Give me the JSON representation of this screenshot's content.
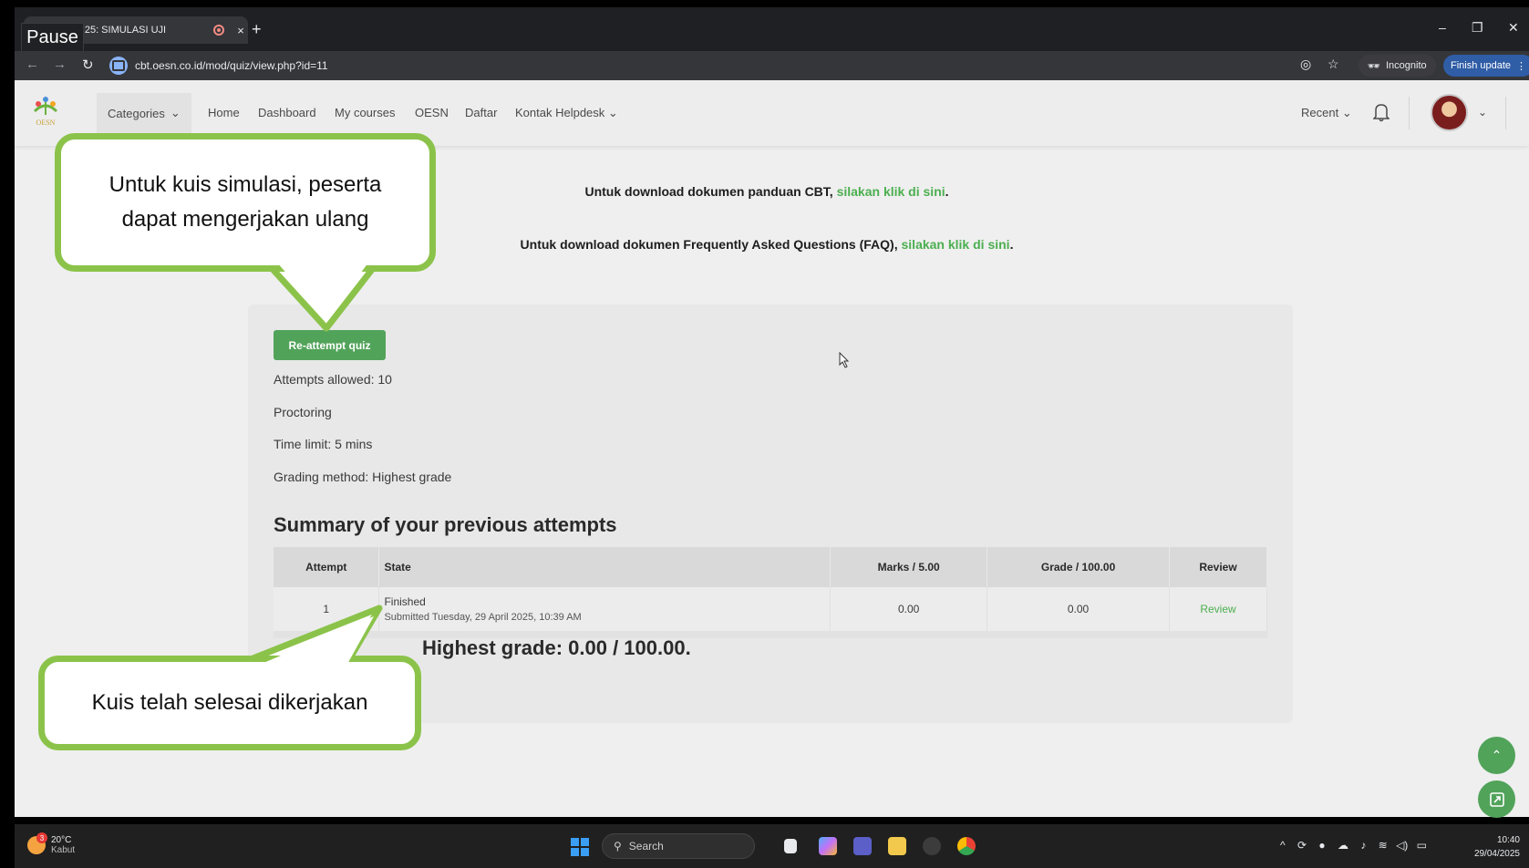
{
  "browser": {
    "tab_title": "-OESN25: SIMULASI UJI",
    "tab_close": "×",
    "new_tab": "+",
    "tooltip": "Pause",
    "url": "cbt.oesn.co.id/mod/quiz/view.php?id=11",
    "incognito_label": "Incognito",
    "finish_update_label": "Finish update"
  },
  "navbar": {
    "logo_text": "OESN",
    "categories": "Categories",
    "items": [
      "Home",
      "Dashboard",
      "My courses",
      "OESN",
      "Daftar",
      "Kontak Helpdesk"
    ],
    "recent": "Recent"
  },
  "info": {
    "line1_text": "Untuk download dokumen panduan CBT, ",
    "line1_link": "silakan klik di sini",
    "line2_text": "Untuk download dokumen Frequently Asked Questions (FAQ), ",
    "line2_link": "silakan klik di sini",
    "period": "."
  },
  "quiz": {
    "reattempt_button": "Re-attempt quiz",
    "attempts_allowed": "Attempts allowed: 10",
    "proctoring": "Proctoring",
    "time_limit": "Time limit: 5 mins",
    "grading_method": "Grading method: Highest grade",
    "summary_heading": "Summary of your previous attempts",
    "table": {
      "headers": [
        "Attempt",
        "State",
        "Marks / 5.00",
        "Grade / 100.00",
        "Review"
      ],
      "rows": [
        {
          "attempt": "1",
          "state": "Finished",
          "submitted": "Submitted Tuesday, 29 April 2025, 10:39 AM",
          "marks": "0.00",
          "grade": "0.00",
          "review": "Review"
        }
      ]
    },
    "highest_grade": "Highest grade: 0.00 / 100.00."
  },
  "callouts": {
    "top_line1": "Untuk kuis simulasi, peserta",
    "top_line2": "dapat mengerjakan ulang",
    "bottom": "Kuis telah selesai dikerjakan"
  },
  "taskbar": {
    "weather_temp": "20°C",
    "weather_desc": "Kabut",
    "weather_badge": "3",
    "search_label": "Search",
    "time": "10:40",
    "date": "29/04/2025"
  },
  "colors": {
    "accent_green": "#52a35a",
    "link_green": "#4caf50",
    "callout_border": "#8bc34a"
  }
}
